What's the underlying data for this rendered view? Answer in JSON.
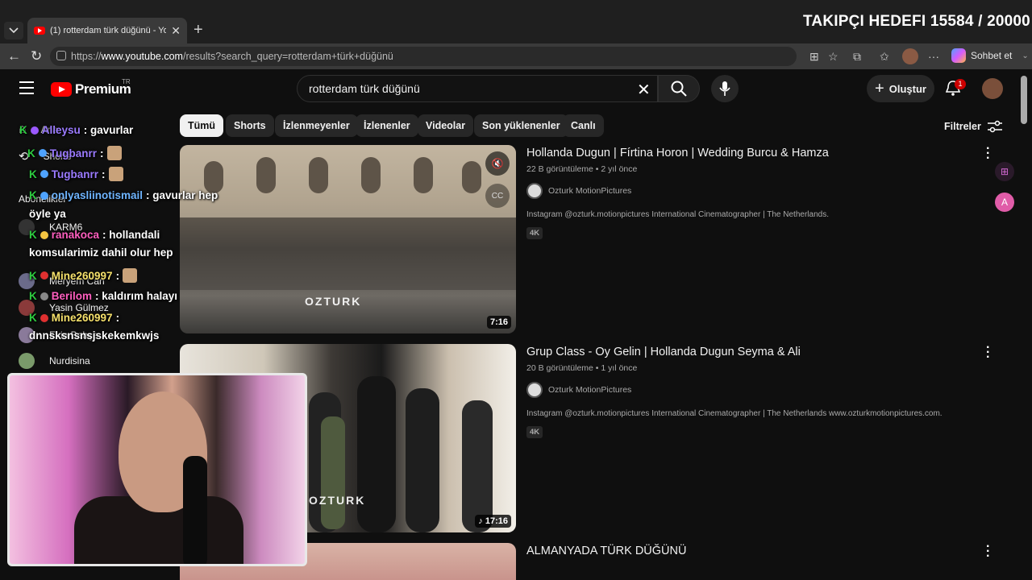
{
  "browser": {
    "tab_title": "(1) rotterdam türk düğünü - YouTube",
    "url_prefix": "https://",
    "url_host": "www.youtube.com",
    "url_path": "/results?search_query=rotterdam+türk+düğünü",
    "copilot_label": "Sohbet et"
  },
  "overlay": {
    "goal_text": "TAKIPÇI HEDEFI 15584 / 20000"
  },
  "header": {
    "logo_word": "Premium",
    "logo_country": "TR",
    "search_value": "rotterdam türk düğünü",
    "create_label": "Oluştur",
    "notification_count": "1"
  },
  "chips": [
    "Tümü",
    "Shorts",
    "İzlenmeyenler",
    "İzlenenler",
    "Videolar",
    "Son yüklenenler",
    "Canlı"
  ],
  "filters_label": "Filtreler",
  "sidebar": {
    "items": [
      {
        "label": "Ana",
        "icon": "home-icon"
      },
      {
        "label": "Shorts",
        "icon": "shorts-icon"
      },
      {
        "label": "Abonelikler",
        "icon": "subscriptions-icon"
      },
      {
        "label": "KARM6",
        "icon": "avatar"
      },
      {
        "label": "Meryem Can",
        "icon": "avatar"
      },
      {
        "label": "Yasin Gülmez",
        "icon": "avatar"
      },
      {
        "label": "Ekin Bahçe",
        "icon": "avatar"
      },
      {
        "label": "Nurdisina",
        "icon": "avatar"
      }
    ]
  },
  "chat": [
    {
      "user": "Alleysu",
      "message": ": gavurlar"
    },
    {
      "user": "Tugbanrr",
      "message": ":"
    },
    {
      "user": "Tugbanrr",
      "message": ":"
    },
    {
      "user": "onlyasliinotismail",
      "message": ": gavurlar hep"
    },
    {
      "user": "",
      "message": "öyle ya"
    },
    {
      "user": "ranakoca",
      "message": ": hollandali"
    },
    {
      "user": "",
      "message": "komsularimiz dahil olur hep"
    },
    {
      "user": "Mine260997",
      "message": ":"
    },
    {
      "user": "Berilom",
      "message": ": kaldırım halayı"
    },
    {
      "user": "Mine260997",
      "message": ":"
    },
    {
      "user": "",
      "message": "dnnsksnsnsjskekemkwjs"
    }
  ],
  "results": [
    {
      "title": "Hollanda Dugun | Fírtina Horon | Wedding Burcu & Hamza",
      "views": "22 B görüntüleme",
      "age": "2 yıl önce",
      "channel": "Ozturk MotionPictures",
      "description": "Instagram @ozturk.motionpictures International Cinematographer | The Netherlands.",
      "badge": "4K",
      "duration": "7:16",
      "watermark": "OZTURK"
    },
    {
      "title": "Grup Class - Oy Gelin | Hollanda Dugun Seyma & Ali",
      "views": "20 B görüntüleme",
      "age": "1 yıl önce",
      "channel": "Ozturk MotionPictures",
      "description": "Instagram @ozturk.motionpictures International Cinematographer | The Netherlands www.ozturkmotionpictures.com.",
      "badge": "4K",
      "duration": "17:16",
      "watermark": "OZTURK"
    },
    {
      "title": "ALMANYADA TÜRK DÜĞÜNÜ"
    }
  ],
  "colors": {
    "background": "#0f0f0f",
    "yt_red": "#ff0000",
    "chip_bg": "#272727",
    "chat_username": "#9b7bff"
  }
}
